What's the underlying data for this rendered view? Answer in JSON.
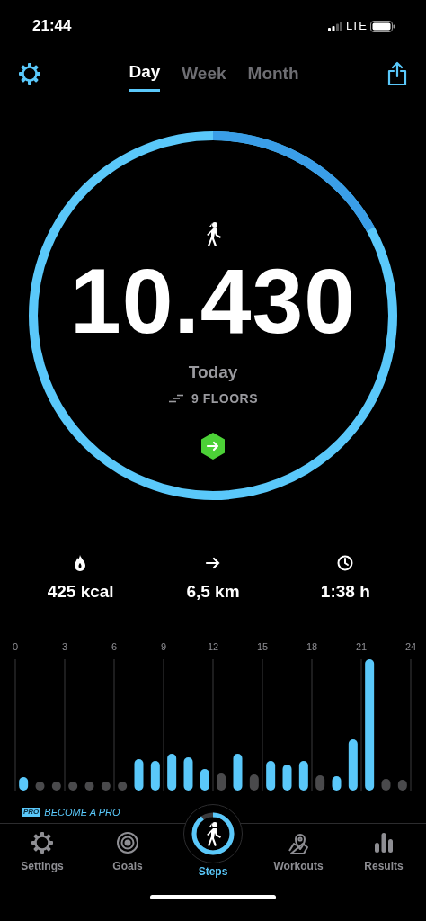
{
  "status_bar": {
    "time": "21:44",
    "network": "LTE"
  },
  "tabs": [
    {
      "label": "Day",
      "selected": true
    },
    {
      "label": "Week",
      "selected": false
    },
    {
      "label": "Month",
      "selected": false
    }
  ],
  "ring": {
    "steps": "10.430",
    "period": "Today",
    "floors": "9 FLOORS"
  },
  "stats": [
    {
      "kind": "calories",
      "value": "425 kcal"
    },
    {
      "kind": "distance",
      "value": "6,5 km"
    },
    {
      "kind": "duration",
      "value": "1:38 h"
    }
  ],
  "chart": {
    "hour_labels": [
      "0",
      "3",
      "6",
      "9",
      "12",
      "15",
      "18",
      "21",
      "24"
    ]
  },
  "promo": {
    "badge": "PRO",
    "text": "BECOME A PRO"
  },
  "nav": [
    {
      "kind": "settings",
      "label": "Settings",
      "selected": false
    },
    {
      "kind": "goals",
      "label": "Goals",
      "selected": false
    },
    {
      "kind": "steps",
      "label": "Steps",
      "selected": true
    },
    {
      "kind": "workouts",
      "label": "Workouts",
      "selected": false
    },
    {
      "kind": "results",
      "label": "Results",
      "selected": false
    }
  ]
}
